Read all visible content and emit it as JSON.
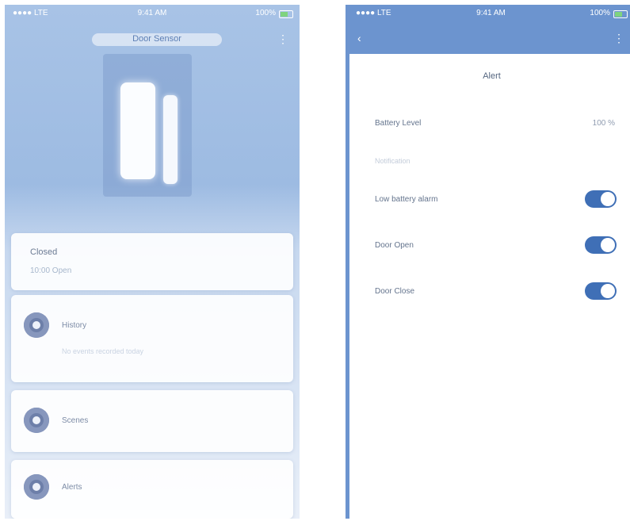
{
  "left": {
    "status": {
      "left": "●●●● LTE",
      "center": "9:41 AM",
      "right": "100%"
    },
    "header": {
      "title": "Door Sensor"
    },
    "status_card": {
      "title": "Closed",
      "subtitle": "10:00 Open"
    },
    "rows": [
      {
        "label": "History",
        "sub": "No events recorded today"
      },
      {
        "label": "Scenes"
      },
      {
        "label": "Alerts"
      }
    ]
  },
  "right": {
    "status": {
      "left": "●●●● LTE",
      "center": "9:41 AM",
      "right": "100%"
    },
    "sheet_title": "Alert",
    "battery_level": {
      "label": "Battery Level",
      "value": "100 %"
    },
    "section_label": "Notification",
    "toggles": [
      {
        "label": "Low battery alarm",
        "on": true
      },
      {
        "label": "Door Open",
        "on": true
      },
      {
        "label": "Door Close",
        "on": true
      }
    ]
  }
}
